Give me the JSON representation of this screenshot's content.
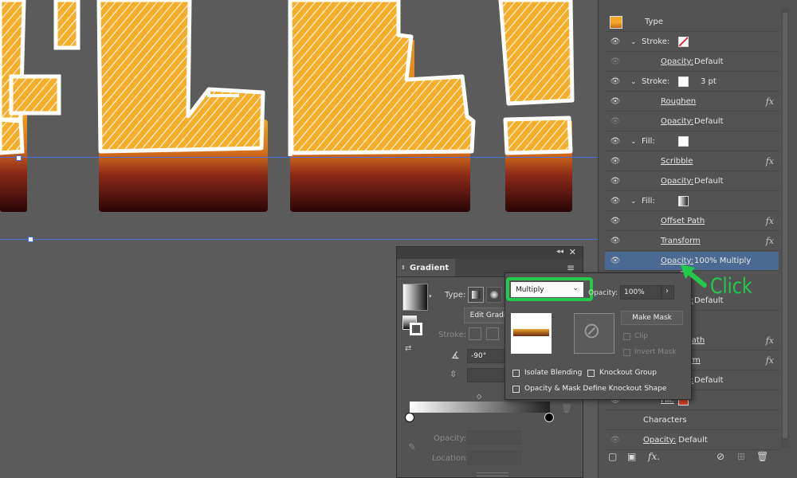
{
  "canvas": {
    "guide_color": "#4a6fd8"
  },
  "appearance": {
    "type_label": "Type",
    "rows": [
      {
        "label": "Stroke:",
        "swatch": "none-red-slash",
        "expand": true
      },
      {
        "label": "Opacity:",
        "value": "Default",
        "dim_eye": true
      },
      {
        "label": "Stroke:",
        "swatch": "white",
        "value": "3 pt",
        "expand": true
      },
      {
        "label": "Roughen",
        "fx": true
      },
      {
        "label": "Opacity:",
        "value": "Default",
        "dim_eye": true
      },
      {
        "label": "Fill:",
        "swatch": "white",
        "expand": true
      },
      {
        "label": "Scribble",
        "fx": true
      },
      {
        "label": "Opacity:",
        "value": "Default"
      },
      {
        "label": "Fill:",
        "swatch": "gradient",
        "expand": true
      },
      {
        "label": "Offset Path",
        "fx": true
      },
      {
        "label": "Transform",
        "fx": true
      },
      {
        "label": "Opacity:",
        "value": "100% Multiply",
        "selected": true
      },
      {
        "label": "Opacity:",
        "value": "Default"
      },
      {
        "label": "Offset Path",
        "fx": true
      },
      {
        "label": "Transform",
        "fx": true
      },
      {
        "label": "Opacity:",
        "value": "Default"
      },
      {
        "label": "Fill:",
        "swatch": "red"
      }
    ],
    "characters_label": "Characters",
    "bottom_opacity_label": "Opacity:",
    "bottom_opacity_value": "Default",
    "fx_label": "fx",
    "fx_button": "fx."
  },
  "gradient_panel": {
    "tab": "Gradient",
    "type_label": "Type:",
    "edit_label": "Edit Gradi",
    "stroke_label": "Stroke:",
    "angle_value": "-90°",
    "opacity_label": "Opacity:",
    "location_label": "Location:"
  },
  "transparency": {
    "blend_mode": "Multiply",
    "opacity_label": "Opacity:",
    "opacity_value": "100%",
    "make_mask": "Make Mask",
    "clip": "Clip",
    "invert_mask": "Invert Mask",
    "isolate_blending": "Isolate Blending",
    "knockout_group": "Knockout Group",
    "opacity_mask_define": "Opacity & Mask Define Knockout Shape"
  },
  "annotation": {
    "text": "Click",
    "color": "#22c94a"
  }
}
